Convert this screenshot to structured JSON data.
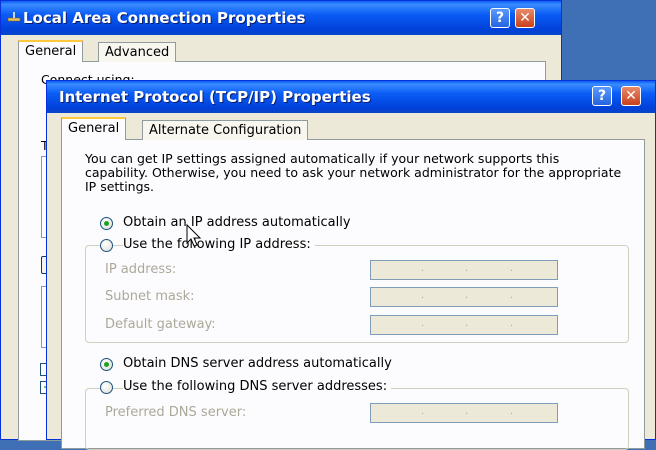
{
  "back_window": {
    "title": "Local Area Connection Properties",
    "tabs": [
      "General",
      "Advanced"
    ],
    "partial_labels": [
      "Connect using:",
      "T"
    ]
  },
  "front_window": {
    "title": "Internet Protocol (TCP/IP) Properties",
    "tabs": [
      "General",
      "Alternate Configuration"
    ],
    "description": "You can get IP settings assigned automatically if your network supports this capability. Otherwise, you need to ask your network administrator for the appropriate IP settings.",
    "ip_mode": {
      "auto_label": "Obtain an IP address automatically",
      "manual_label": "Use the following IP address:",
      "selected": "auto"
    },
    "ip_fields": [
      {
        "label": "IP address:",
        "value": ""
      },
      {
        "label": "Subnet mask:",
        "value": ""
      },
      {
        "label": "Default gateway:",
        "value": ""
      }
    ],
    "dns_mode": {
      "auto_label": "Obtain DNS server address automatically",
      "manual_label": "Use the following DNS server addresses:",
      "selected": "auto"
    },
    "dns_fields": [
      {
        "label": "Preferred DNS server:",
        "value": ""
      }
    ]
  },
  "icons": [
    "help-icon",
    "close-icon",
    "network-icon",
    "mouse-pointer-icon"
  ],
  "colors": {
    "title_bar": "#0a5cf5",
    "window_bg": "#ece9d8",
    "close_button": "#c8401c",
    "tab_highlight": "#ffc83c"
  }
}
